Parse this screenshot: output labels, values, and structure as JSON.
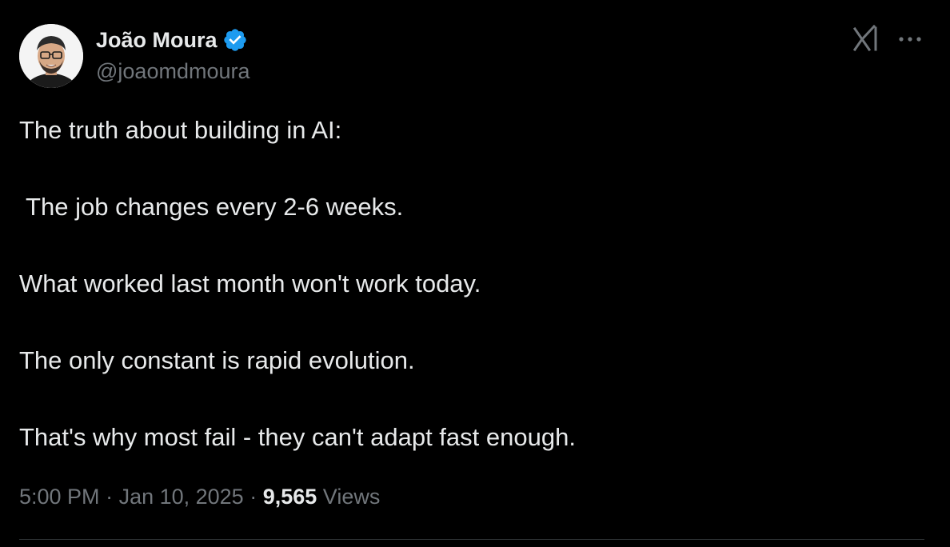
{
  "author": {
    "name": "João Moura",
    "handle": "@joaomdmoura",
    "verified": true,
    "avatar_icon": "avatar"
  },
  "tweet": {
    "lines": [
      "The truth about building in AI:",
      " The job changes every 2-6 weeks.",
      "What worked last month won't work today.",
      "The only constant is rapid evolution.",
      "That's why most fail - they can't adapt fast enough."
    ]
  },
  "meta": {
    "time": "5:00 PM",
    "separator": " · ",
    "date": "Jan 10, 2025",
    "views_count": "9,565",
    "views_label": "Views"
  },
  "icons": {
    "verified_badge": "verified-badge-icon",
    "grok": "grok-icon",
    "more": "more-options-icon"
  },
  "colors": {
    "background": "#000000",
    "text": "#e7e9ea",
    "secondary_text": "#71767b",
    "verified_blue": "#1d9bf0",
    "divider": "#2f3336"
  }
}
